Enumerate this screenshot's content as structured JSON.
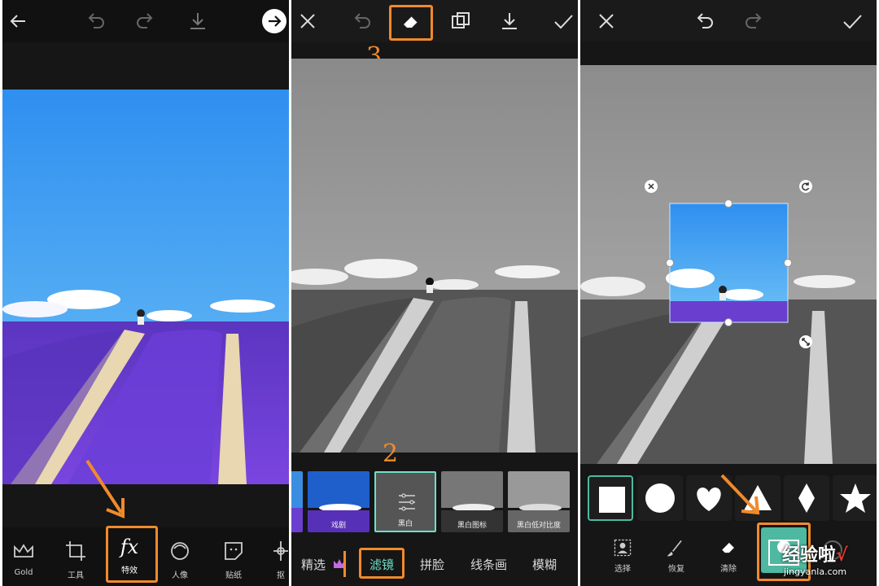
{
  "panel1": {
    "tools": [
      {
        "label": "Gold",
        "icon": "crown-icon"
      },
      {
        "label": "工具",
        "icon": "crop-icon"
      },
      {
        "label": "特效",
        "icon": "fx-icon"
      },
      {
        "label": "人像",
        "icon": "portrait-icon"
      },
      {
        "label": "贴纸",
        "icon": "sticker-icon"
      },
      {
        "label": "抠",
        "icon": "cutout-icon"
      }
    ],
    "fx_glyph": "fx"
  },
  "panel2": {
    "step_number": "3",
    "step2_number": "2",
    "thumbnails": [
      {
        "label": ""
      },
      {
        "label": "戏剧"
      },
      {
        "label": "黑白"
      },
      {
        "label": "黑白图标"
      },
      {
        "label": "黑白低对比度"
      }
    ],
    "tabs": [
      "精选",
      "滤镜",
      "拼脸",
      "线条画",
      "模糊"
    ]
  },
  "panel3": {
    "tools": [
      {
        "label": "选择",
        "icon": "select-person-icon"
      },
      {
        "label": "恢复",
        "icon": "brush-icon"
      },
      {
        "label": "清除",
        "icon": "eraser-icon"
      }
    ],
    "shapes": [
      "square",
      "circle",
      "heart",
      "triangle",
      "diamond",
      "star"
    ],
    "watermark_text": "经验啦",
    "watermark_check": "√",
    "watermark_url": "jingyanla.com"
  },
  "colors": {
    "highlight": "#f08a2c",
    "teal": "#4fb8a0",
    "sky": "#3aa0ee",
    "lavender": "#6a3fd0"
  }
}
